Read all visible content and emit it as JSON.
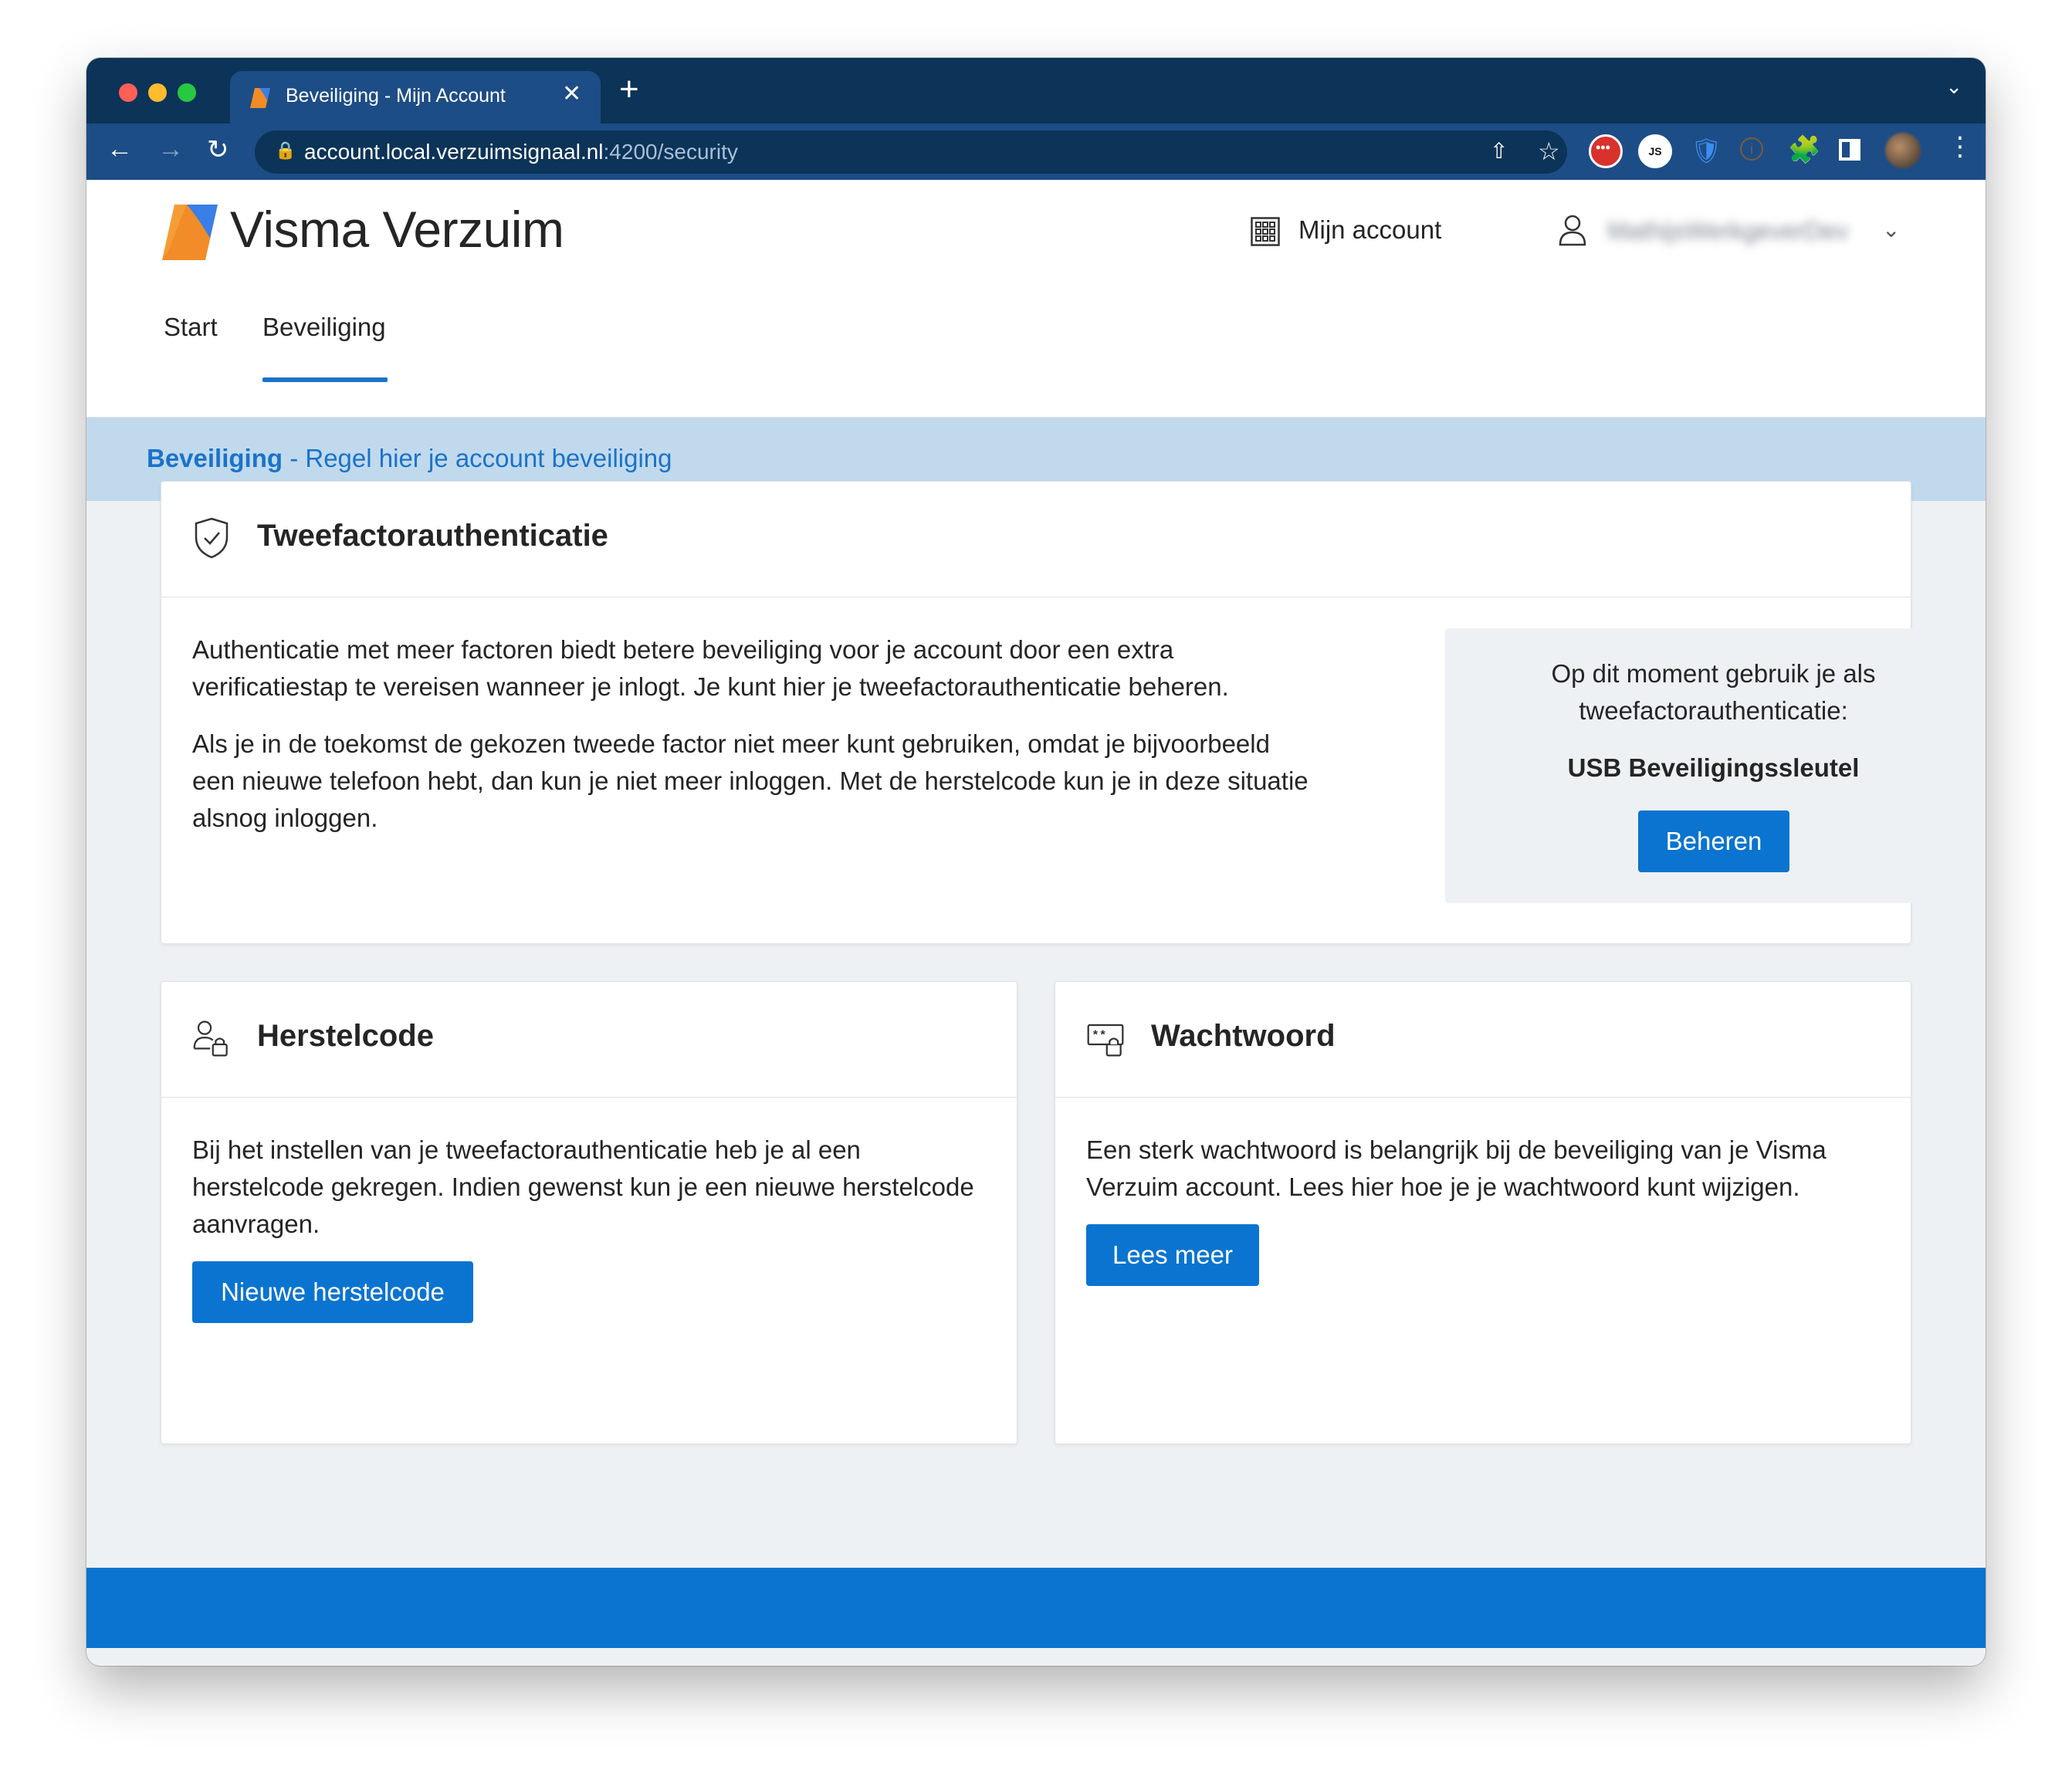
{
  "browser": {
    "tab_title": "Beveiliging - Mijn Account",
    "tab_close": "✕",
    "new_tab": "+",
    "url_host": "account.local.verzuimsignaal.nl",
    "url_path": ":4200/security",
    "extension_js_label": "JS"
  },
  "header": {
    "brand_light": "Visma",
    "brand_bold": "Verzuim",
    "account_label": "Mijn account",
    "user_name": "MathijsWerkgeverDev"
  },
  "nav": {
    "tabs": [
      {
        "label": "Start"
      },
      {
        "label": "Beveiliging",
        "active": true
      }
    ]
  },
  "banner": {
    "title": "Beveiliging",
    "separator": " - ",
    "subtitle": "Regel hier je account beveiliging"
  },
  "twofa": {
    "title": "Tweefactorauthenticatie",
    "paragraph1": "Authenticatie met meer factoren biedt betere beveiliging voor je account door een extra verificatiestap te vereisen wanneer je inlogt. Je kunt hier je tweefactorauthenticatie beheren.",
    "paragraph2": "Als je in de toekomst de gekozen tweede factor niet meer kunt gebruiken, omdat je bijvoorbeeld een nieuwe telefoon hebt, dan kun je niet meer inloggen. Met de herstelcode kun je in deze situatie alsnog inloggen.",
    "status_line1": "Op dit moment gebruik je als",
    "status_line2": "tweefactorauthenticatie:",
    "status_value": "USB Beveiligingssleutel",
    "button": "Beheren"
  },
  "herstelcode": {
    "title": "Herstelcode",
    "text": "Bij het instellen van je tweefactorauthenticatie heb je al een herstelcode gekregen. Indien gewenst kun je een nieuwe herstelcode aanvragen.",
    "button": "Nieuwe herstelcode"
  },
  "wachtwoord": {
    "title": "Wachtwoord",
    "text": "Een sterk wachtwoord is belangrijk bij de beveiliging van je Visma Verzuim account. Lees hier hoe je je wachtwoord kunt wijzigen.",
    "button": "Lees meer"
  },
  "colors": {
    "browser_dark": "#0c3358",
    "browser_tab": "#1d4d86",
    "primary": "#0a74d0",
    "link": "#1a73c9",
    "banner": "#c1d9ec",
    "page_bg": "#eef1f4"
  }
}
